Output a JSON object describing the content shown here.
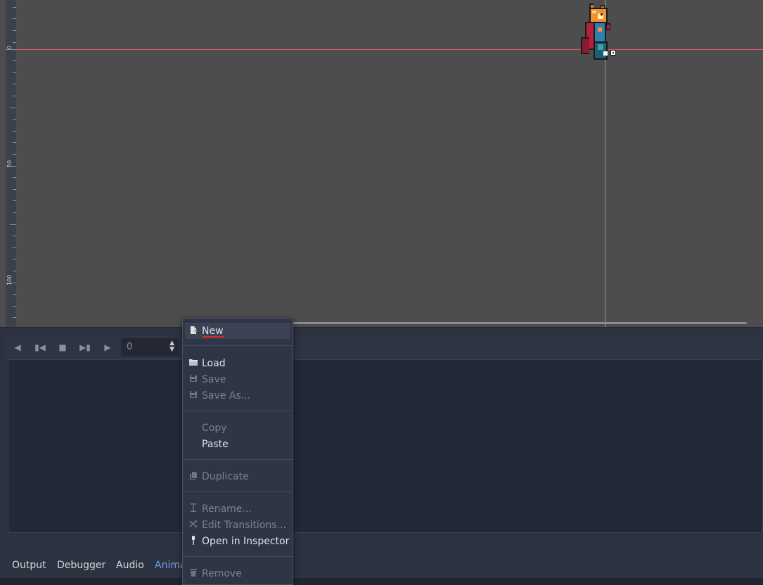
{
  "viewport": {
    "ruler_labels": [
      "0",
      "50",
      "100"
    ],
    "axis_colors": {
      "x_axis": "#e05b6a",
      "y_axis": "#8fbf8f"
    }
  },
  "animation_toolbar": {
    "frame_value": "0",
    "buttons": [
      "play-backwards-icon",
      "play-backwards-from-end-icon",
      "stop-icon",
      "play-from-start-icon",
      "play-icon"
    ]
  },
  "context_menu": {
    "items": [
      {
        "label": "New",
        "icon": "new-file-icon",
        "enabled": true,
        "highlighted": true
      },
      {
        "label": "Load",
        "icon": "folder-icon",
        "enabled": true
      },
      {
        "label": "Save",
        "icon": "save-icon",
        "enabled": false
      },
      {
        "label": "Save As...",
        "icon": "save-icon",
        "enabled": false
      },
      {
        "label": "Copy",
        "icon": "",
        "enabled": false
      },
      {
        "label": "Paste",
        "icon": "",
        "enabled": true
      },
      {
        "label": "Duplicate",
        "icon": "duplicate-icon",
        "enabled": false
      },
      {
        "label": "Rename...",
        "icon": "text-cursor-icon",
        "enabled": false
      },
      {
        "label": "Edit Transitions...",
        "icon": "transitions-icon",
        "enabled": false
      },
      {
        "label": "Open in Inspector",
        "icon": "pin-icon",
        "enabled": true
      },
      {
        "label": "Remove",
        "icon": "trash-icon",
        "enabled": false
      }
    ]
  },
  "dock_tabs": [
    {
      "label": "Output"
    },
    {
      "label": "Debugger"
    },
    {
      "label": "Audio"
    },
    {
      "label": "Anima",
      "active": true
    }
  ],
  "colors": {
    "accent": "#6ca1e3",
    "highlight_underline": "#d92b2b"
  }
}
